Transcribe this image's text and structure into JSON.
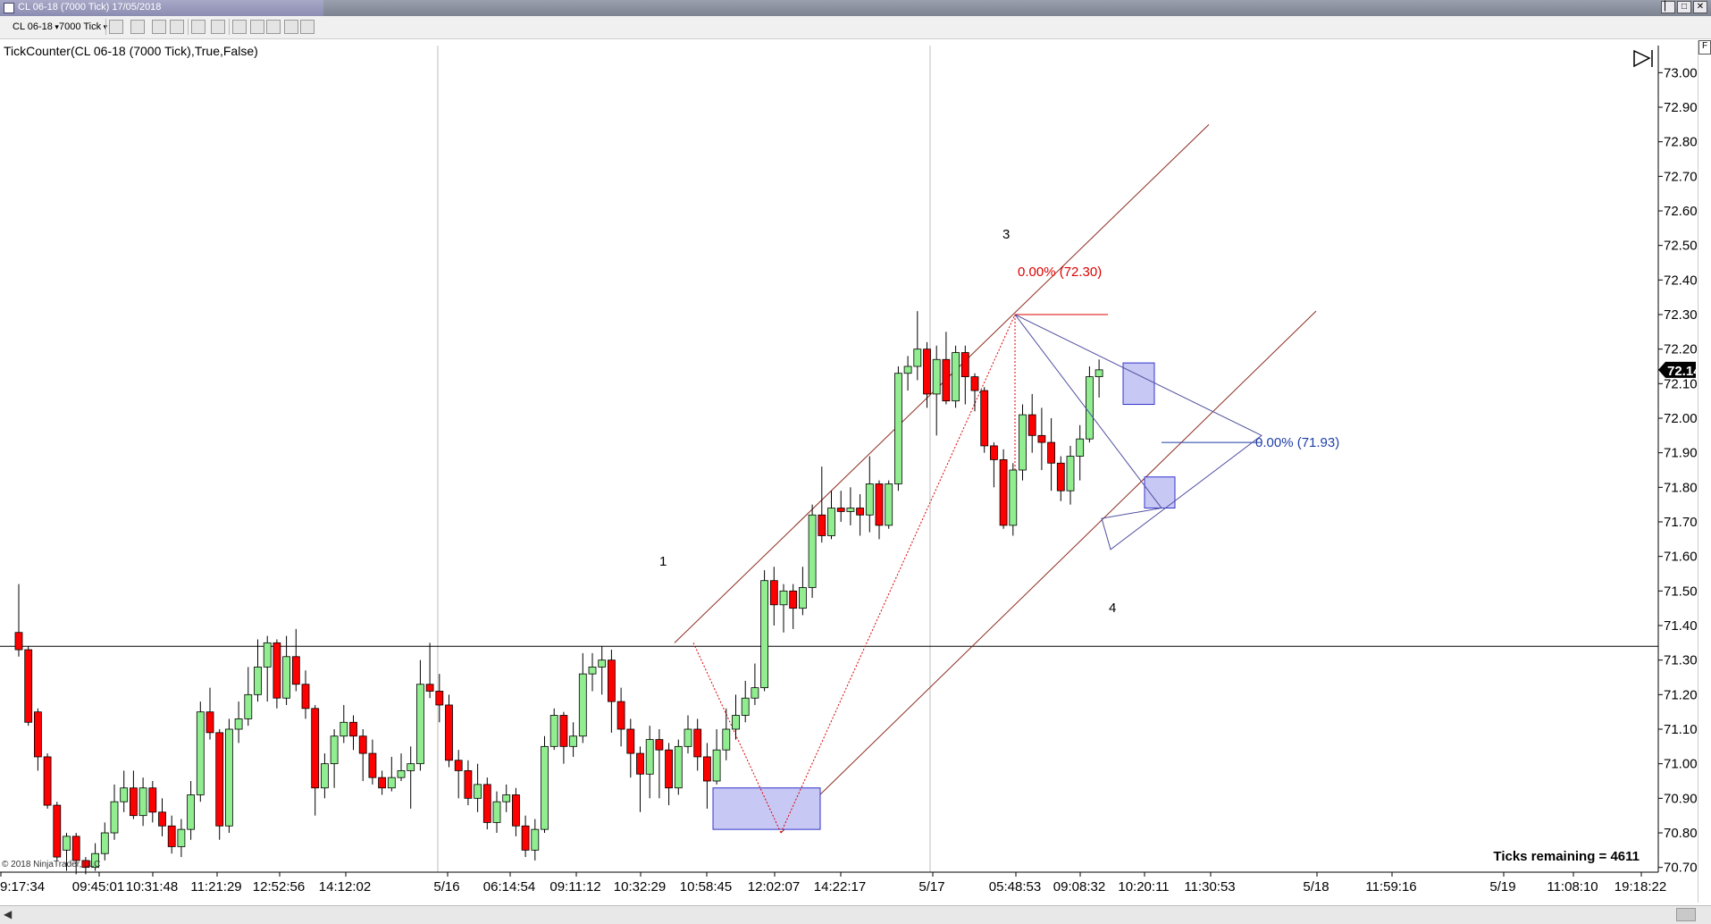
{
  "window": {
    "title": "CL 06-18 (7000 Tick)  17/05/2018",
    "buttons": [
      "▏",
      "□",
      "✕"
    ]
  },
  "toolbar": {
    "instrument": "CL 06-18",
    "interval": "7000 Tick",
    "icons": [
      "bars-type-icon",
      "pencil-draw-icon",
      "crosshair-icon",
      "zoom-icon",
      "properties-icon",
      "chart-trader-icon",
      "data-box-icon",
      "template-icon",
      "cursor-icon",
      "search-icon"
    ]
  },
  "indicator_label": "TickCounter(CL 06-18 (7000 Tick),True,False)",
  "chart_data": {
    "type": "candlestick",
    "y_axis": {
      "range": [
        70.68,
        73.06
      ],
      "ticks": [
        "73.00",
        "72.90",
        "72.80",
        "72.70",
        "72.60",
        "72.50",
        "72.40",
        "72.30",
        "72.20",
        "72.10",
        "72.00",
        "71.90",
        "71.80",
        "71.70",
        "71.60",
        "71.50",
        "71.40",
        "71.30",
        "71.20",
        "71.10",
        "71.00",
        "70.90",
        "70.80",
        "70.70"
      ],
      "last_price": "72.14",
      "horizontal_line": 71.34
    },
    "x_axis": {
      "ticks": [
        "9:17:34",
        "09:45:01",
        "10:31:48",
        "11:21:29",
        "12:52:56",
        "14:12:02",
        "5/16",
        "06:14:54",
        "09:11:12",
        "10:32:29",
        "10:58:45",
        "12:02:07",
        "14:22:17",
        "5/17",
        "05:48:53",
        "09:08:32",
        "10:20:11",
        "11:30:53",
        "5/18",
        "11:59:16",
        "5/19",
        "11:08:10",
        "19:18:22"
      ]
    },
    "candles": [
      [
        71.38,
        71.33,
        71.52,
        71.31
      ],
      [
        71.33,
        71.12,
        71.34,
        71.11
      ],
      [
        71.15,
        71.02,
        71.16,
        70.98
      ],
      [
        71.02,
        70.88,
        71.03,
        70.87
      ],
      [
        70.88,
        70.73,
        70.89,
        70.72
      ],
      [
        70.75,
        70.79,
        70.8,
        70.69
      ],
      [
        70.79,
        70.72,
        70.8,
        70.68
      ],
      [
        70.72,
        70.7,
        70.73,
        70.68
      ],
      [
        70.7,
        70.74,
        70.77,
        70.69
      ],
      [
        70.74,
        70.8,
        70.83,
        70.72
      ],
      [
        70.8,
        70.89,
        70.94,
        70.78
      ],
      [
        70.89,
        70.93,
        70.98,
        70.86
      ],
      [
        70.93,
        70.85,
        70.98,
        70.84
      ],
      [
        70.85,
        70.93,
        70.96,
        70.82
      ],
      [
        70.93,
        70.86,
        70.95,
        70.83
      ],
      [
        70.86,
        70.82,
        70.9,
        70.79
      ],
      [
        70.82,
        70.76,
        70.85,
        70.74
      ],
      [
        70.76,
        70.81,
        70.84,
        70.73
      ],
      [
        70.81,
        70.91,
        70.95,
        70.78
      ],
      [
        70.91,
        71.15,
        71.18,
        70.89
      ],
      [
        71.15,
        71.09,
        71.22,
        71.07
      ],
      [
        71.09,
        70.82,
        71.1,
        70.78
      ],
      [
        70.82,
        71.1,
        71.13,
        70.8
      ],
      [
        71.1,
        71.13,
        71.18,
        71.06
      ],
      [
        71.13,
        71.2,
        71.28,
        71.11
      ],
      [
        71.2,
        71.28,
        71.36,
        71.18
      ],
      [
        71.28,
        71.35,
        71.37,
        71.18
      ],
      [
        71.35,
        71.19,
        71.36,
        71.16
      ],
      [
        71.19,
        71.31,
        71.37,
        71.17
      ],
      [
        71.31,
        71.23,
        71.39,
        71.21
      ],
      [
        71.23,
        71.16,
        71.27,
        71.13
      ],
      [
        71.16,
        70.93,
        71.17,
        70.85
      ],
      [
        70.93,
        71.0,
        71.03,
        70.9
      ],
      [
        71.0,
        71.08,
        71.1,
        70.93
      ],
      [
        71.08,
        71.12,
        71.17,
        71.06
      ],
      [
        71.12,
        71.08,
        71.14,
        71.04
      ],
      [
        71.08,
        71.03,
        71.1,
        70.95
      ],
      [
        71.03,
        70.96,
        71.07,
        70.94
      ],
      [
        70.96,
        70.93,
        70.98,
        70.91
      ],
      [
        70.93,
        70.96,
        71.02,
        70.92
      ],
      [
        70.96,
        70.98,
        71.03,
        70.95
      ],
      [
        70.98,
        71.0,
        71.05,
        70.87
      ],
      [
        71.0,
        71.23,
        71.3,
        70.98
      ],
      [
        71.23,
        71.21,
        71.35,
        71.19
      ],
      [
        71.21,
        71.17,
        71.26,
        71.12
      ],
      [
        71.17,
        71.01,
        71.2,
        70.99
      ],
      [
        71.01,
        70.98,
        71.04,
        70.9
      ],
      [
        70.98,
        70.9,
        71.01,
        70.88
      ],
      [
        70.9,
        70.94,
        71.0,
        70.86
      ],
      [
        70.94,
        70.83,
        70.96,
        70.81
      ],
      [
        70.83,
        70.89,
        70.92,
        70.8
      ],
      [
        70.89,
        70.91,
        70.94,
        70.86
      ],
      [
        70.91,
        70.82,
        70.93,
        70.79
      ],
      [
        70.82,
        70.75,
        70.85,
        70.73
      ],
      [
        70.75,
        70.81,
        70.84,
        70.72
      ],
      [
        70.81,
        71.05,
        71.08,
        70.8
      ],
      [
        71.05,
        71.14,
        71.16,
        71.04
      ],
      [
        71.14,
        71.05,
        71.15,
        71.0
      ],
      [
        71.05,
        71.08,
        71.12,
        71.02
      ],
      [
        71.08,
        71.26,
        71.32,
        71.06
      ],
      [
        71.26,
        71.28,
        71.32,
        71.21
      ],
      [
        71.28,
        71.3,
        71.34,
        71.2
      ],
      [
        71.3,
        71.18,
        71.33,
        71.09
      ],
      [
        71.18,
        71.1,
        71.22,
        71.05
      ],
      [
        71.1,
        71.03,
        71.13,
        70.96
      ],
      [
        71.03,
        70.97,
        71.05,
        70.86
      ],
      [
        70.97,
        71.07,
        71.11,
        70.9
      ],
      [
        71.07,
        71.04,
        71.1,
        70.9
      ],
      [
        71.04,
        70.93,
        71.06,
        70.88
      ],
      [
        70.93,
        71.05,
        71.07,
        70.91
      ],
      [
        71.05,
        71.1,
        71.14,
        71.03
      ],
      [
        71.1,
        71.02,
        71.13,
        70.98
      ],
      [
        71.02,
        70.95,
        71.06,
        70.87
      ],
      [
        70.95,
        71.04,
        71.1,
        70.94
      ],
      [
        71.04,
        71.1,
        71.16,
        71.01
      ],
      [
        71.1,
        71.14,
        71.2,
        71.07
      ],
      [
        71.14,
        71.19,
        71.24,
        71.12
      ],
      [
        71.19,
        71.22,
        71.29,
        71.17
      ],
      [
        71.22,
        71.53,
        71.56,
        71.21
      ],
      [
        71.53,
        71.46,
        71.57,
        71.4
      ],
      [
        71.46,
        71.5,
        71.52,
        71.38
      ],
      [
        71.5,
        71.45,
        71.52,
        71.39
      ],
      [
        71.45,
        71.51,
        71.57,
        71.43
      ],
      [
        71.51,
        71.72,
        71.75,
        71.48
      ],
      [
        71.72,
        71.66,
        71.86,
        71.64
      ],
      [
        71.66,
        71.74,
        71.79,
        71.65
      ],
      [
        71.74,
        71.73,
        71.79,
        71.7
      ],
      [
        71.73,
        71.74,
        71.8,
        71.69
      ],
      [
        71.74,
        71.72,
        71.78,
        71.66
      ],
      [
        71.72,
        71.81,
        71.89,
        71.67
      ],
      [
        71.81,
        71.69,
        71.82,
        71.65
      ],
      [
        71.69,
        71.81,
        71.82,
        71.68
      ],
      [
        71.81,
        72.13,
        72.15,
        71.79
      ],
      [
        72.13,
        72.15,
        72.18,
        72.08
      ],
      [
        72.15,
        72.2,
        72.31,
        72.11
      ],
      [
        72.2,
        72.07,
        72.22,
        72.03
      ],
      [
        72.07,
        72.17,
        72.21,
        71.95
      ],
      [
        72.17,
        72.05,
        72.25,
        72.04
      ],
      [
        72.05,
        72.19,
        72.21,
        72.03
      ],
      [
        72.19,
        72.12,
        72.21,
        72.04
      ],
      [
        72.12,
        72.08,
        72.13,
        72.02
      ],
      [
        72.08,
        71.92,
        72.09,
        71.9
      ],
      [
        71.92,
        71.88,
        71.93,
        71.8
      ],
      [
        71.88,
        71.69,
        71.91,
        71.68
      ],
      [
        71.69,
        71.85,
        71.87,
        71.66
      ],
      [
        71.85,
        72.01,
        72.04,
        71.82
      ],
      [
        72.01,
        71.95,
        72.07,
        71.9
      ],
      [
        71.95,
        71.93,
        72.03,
        71.85
      ],
      [
        71.93,
        71.87,
        72.0,
        71.79
      ],
      [
        71.87,
        71.79,
        71.89,
        71.76
      ],
      [
        71.79,
        71.89,
        71.92,
        71.75
      ],
      [
        71.89,
        71.94,
        71.98,
        71.82
      ],
      [
        71.94,
        72.12,
        72.15,
        71.93
      ],
      [
        72.12,
        72.14,
        72.17,
        72.06
      ]
    ],
    "drawings": {
      "fib_top_label": "0.00% (72.30)",
      "fib_right_label": "0.00% (71.93)",
      "wave_labels": [
        "1",
        "3",
        "4"
      ]
    },
    "ticks_remaining": "Ticks remaining = 4611",
    "copyright": "© 2018 NinjaTrader, LLC",
    "colors": {
      "up_candle": "#90ee90",
      "down_candle": "#ff0000",
      "channel": "#8b2c1f",
      "fib_red": "#dd0000",
      "fib_blue": "#1f3fa8",
      "box_fill": "#c8c8f5",
      "box_stroke": "#3333cc",
      "triangle": "#5050a0"
    }
  }
}
